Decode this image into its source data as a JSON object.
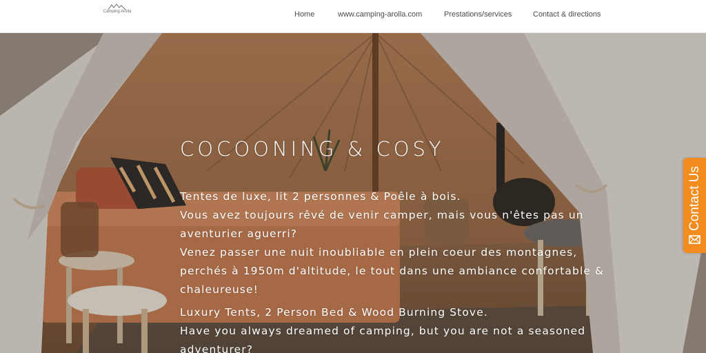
{
  "header": {
    "logo_text": "Camping Arolla",
    "nav": [
      "Home",
      "www.camping-arolla.com",
      "Prestations/services",
      "Contact & directions"
    ]
  },
  "hero": {
    "title": "COCOONING & COSY",
    "fr_lines": [
      "Tentes de luxe, lit 2 personnes & Poêle à bois.",
      "Vous avez toujours rêvé de venir camper, mais vous n'êtes pas un",
      "aventurier aguerri?",
      "Venez passer une nuit inoubliable en plein coeur des montagnes,",
      "perchés à 1950m d'altitude, le tout dans une ambiance confortable &",
      "chaleureuse!"
    ],
    "en_lines": [
      "Luxury Tents, 2 Person Bed & Wood Burning Stove.",
      "Have you always dreamed of camping, but you are not a seasoned",
      "adventurer?"
    ]
  },
  "contact_tab": {
    "label": "Contact Us"
  },
  "colors": {
    "accent": "#f28c1f",
    "header_bg": "#ffffff",
    "nav_text": "#4a4a4a"
  },
  "icons": {
    "logo": "mountain-logo-icon",
    "contact": "mail-icon"
  }
}
